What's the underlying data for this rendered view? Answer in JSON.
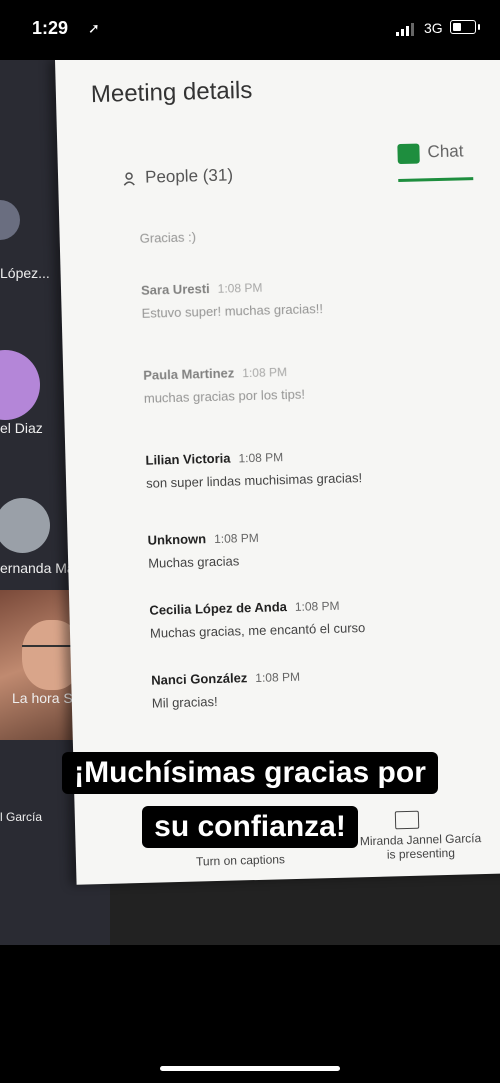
{
  "status": {
    "time": "1:29",
    "network": "3G"
  },
  "gallery": {
    "names": [
      "López...",
      "el Diaz",
      "ernanda Ma...",
      "La hora Sat ...",
      "l García"
    ]
  },
  "panel": {
    "title": "Meeting details",
    "tabs": {
      "people": "People (31)",
      "chat": "Chat"
    },
    "messages": [
      {
        "sender": "",
        "time": "",
        "text": "Gracias :)"
      },
      {
        "sender": "Sara Uresti",
        "time": "1:08 PM",
        "text": "Estuvo super! muchas gracias!!"
      },
      {
        "sender": "Paula Martinez",
        "time": "1:08 PM",
        "text": "muchas gracias por los tips!"
      },
      {
        "sender": "Lilian Victoria",
        "time": "1:08 PM",
        "text": "son super lindas muchisimas gracias!"
      },
      {
        "sender": "Unknown",
        "time": "1:08 PM",
        "text": "Muchas gracias"
      },
      {
        "sender": "Cecilia López de Anda",
        "time": "1:08 PM",
        "text": "Muchas gracias, me encantó el curso"
      },
      {
        "sender": "Nanci González",
        "time": "1:08 PM",
        "text": "Mil gracias!"
      }
    ],
    "bottom": {
      "captions": "Turn on captions",
      "presenter_line1": "Miranda Jannel García",
      "presenter_line2": "is presenting"
    }
  },
  "overlay": {
    "line1": "¡Muchísimas gracias por",
    "line2": "su confianza!"
  },
  "colors": {
    "accent": "#1e8e3e"
  }
}
